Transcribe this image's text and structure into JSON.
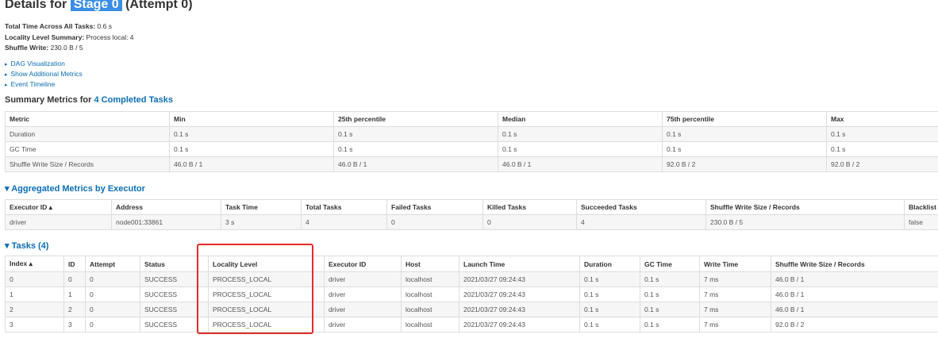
{
  "title": {
    "prefix": "Details for",
    "stage": "Stage 0",
    "suffix": "(Attempt 0)"
  },
  "info": [
    {
      "label": "Total Time Across All Tasks:",
      "value": "0.6 s"
    },
    {
      "label": "Locality Level Summary:",
      "value": "Process local: 4"
    },
    {
      "label": "Shuffle Write:",
      "value": "230.0 B / 5"
    }
  ],
  "links": [
    "DAG Visualization",
    "Show Additional Metrics",
    "Event Timeline"
  ],
  "summary": {
    "heading_prefix": "Summary Metrics for",
    "heading_link": "4 Completed Tasks",
    "headers": [
      "Metric",
      "Min",
      "25th percentile",
      "Median",
      "75th percentile",
      "Max"
    ],
    "rows": [
      [
        "Duration",
        "0.1 s",
        "0.1 s",
        "0.1 s",
        "0.1 s",
        "0.1 s"
      ],
      [
        "GC Time",
        "0.1 s",
        "0.1 s",
        "0.1 s",
        "0.1 s",
        "0.1 s"
      ],
      [
        "Shuffle Write Size / Records",
        "46.0 B / 1",
        "46.0 B / 1",
        "46.0 B / 1",
        "92.0 B / 2",
        "92.0 B / 2"
      ]
    ]
  },
  "aggregated": {
    "heading": "Aggregated Metrics by Executor",
    "headers": [
      "Executor ID",
      "Address",
      "Task Time",
      "Total Tasks",
      "Failed Tasks",
      "Killed Tasks",
      "Succeeded Tasks",
      "Shuffle Write Size / Records",
      "Blacklist"
    ],
    "rows": [
      [
        "driver",
        "node001:33861",
        "3 s",
        "4",
        "0",
        "0",
        "4",
        "230.0 B / 5",
        "false"
      ]
    ]
  },
  "tasks": {
    "heading": "Tasks (4)",
    "headers": [
      "Index",
      "ID",
      "Attempt",
      "Status",
      "Locality Level",
      "Executor ID",
      "Host",
      "Launch Time",
      "Duration",
      "GC Time",
      "Write Time",
      "Shuffle Write Size / Records"
    ],
    "rows": [
      [
        "0",
        "0",
        "0",
        "SUCCESS",
        "PROCESS_LOCAL",
        "driver",
        "localhost",
        "2021/03/27 09:24:43",
        "0.1 s",
        "0.1 s",
        "7 ms",
        "46.0 B / 1"
      ],
      [
        "1",
        "1",
        "0",
        "SUCCESS",
        "PROCESS_LOCAL",
        "driver",
        "localhost",
        "2021/03/27 09:24:43",
        "0.1 s",
        "0.1 s",
        "7 ms",
        "46.0 B / 1"
      ],
      [
        "2",
        "2",
        "0",
        "SUCCESS",
        "PROCESS_LOCAL",
        "driver",
        "localhost",
        "2021/03/27 09:24:43",
        "0.1 s",
        "0.1 s",
        "7 ms",
        "46.0 B / 1"
      ],
      [
        "3",
        "3",
        "0",
        "SUCCESS",
        "PROCESS_LOCAL",
        "driver",
        "localhost",
        "2021/03/27 09:24:43",
        "0.1 s",
        "0.1 s",
        "7 ms",
        "92.0 B / 2"
      ]
    ]
  },
  "icons": {
    "triangle_right": "▸",
    "triangle_down": "▾",
    "sort_up": "▴"
  },
  "colors": {
    "link": "#0b6fb4",
    "highlight": "#3a8ee6",
    "annotation": "#e52b2b"
  }
}
